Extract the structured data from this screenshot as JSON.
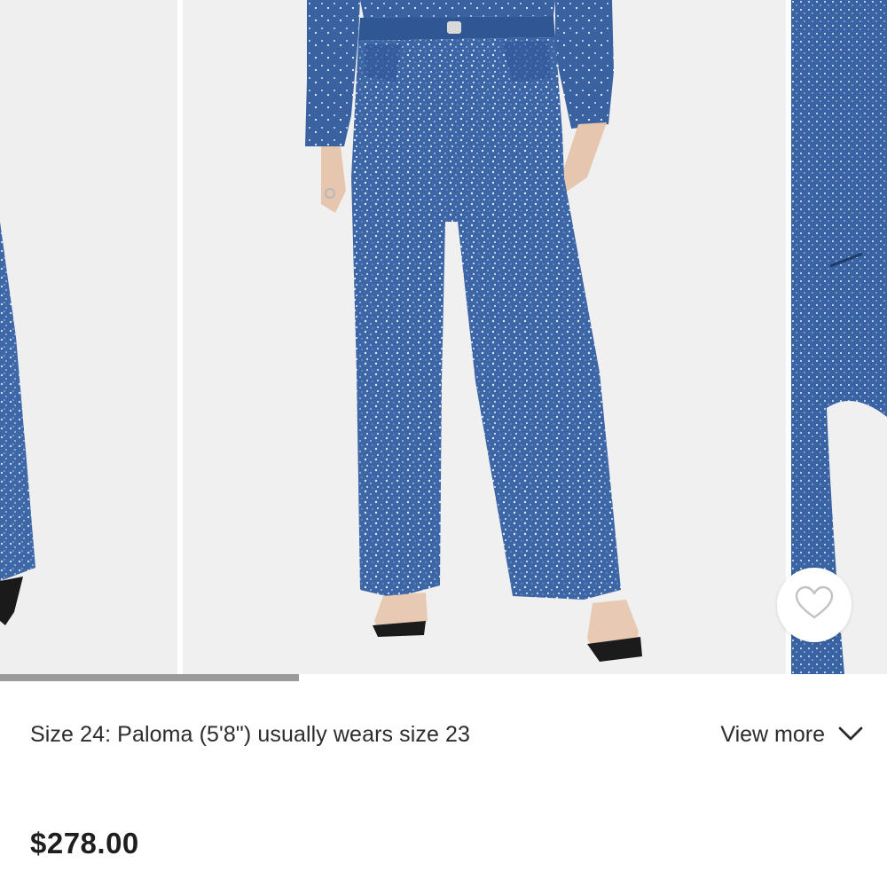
{
  "product": {
    "size_info": "Size 24: Paloma (5'8\") usually wears size 23",
    "view_more_label": "View more",
    "price": "$278.00"
  },
  "gallery": {
    "image_count": 3,
    "progress_fraction": 0.337
  },
  "icons": {
    "wishlist": "heart-outline-icon",
    "expand": "chevron-down-icon"
  },
  "colors": {
    "denim": "#3f67a6",
    "progress": "#9a9a9a",
    "text": "#2c2c2c"
  }
}
